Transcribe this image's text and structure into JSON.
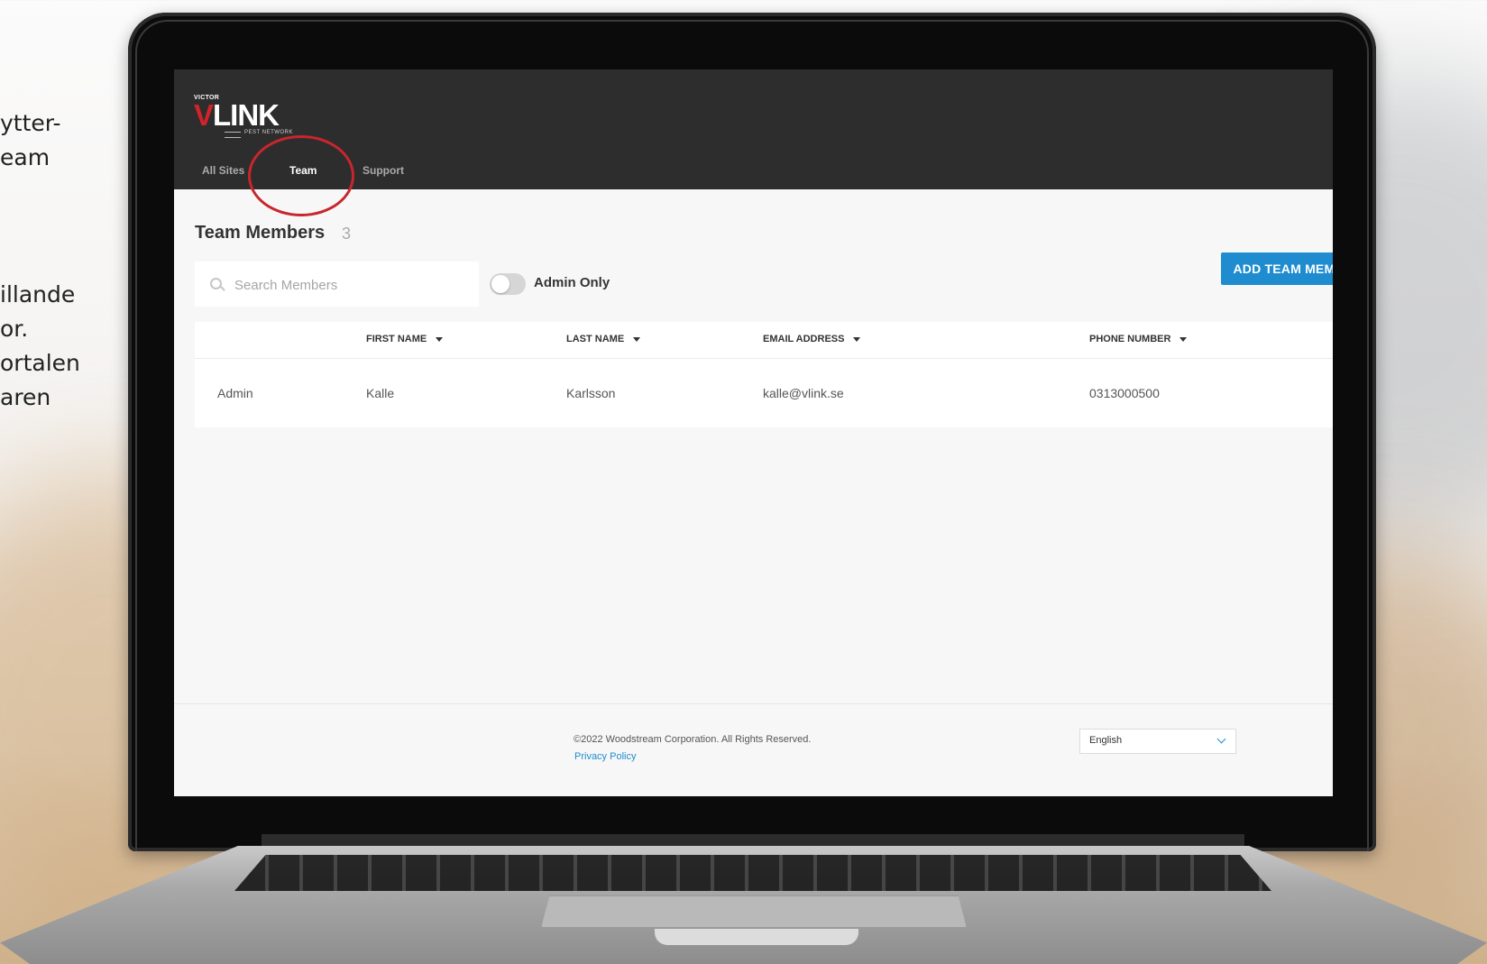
{
  "left_copy": {
    "top_lines": [
      "ytter-",
      "eam"
    ],
    "mid_lines": [
      "illande",
      "or.",
      "ortalen",
      "aren"
    ]
  },
  "app": {
    "logo": {
      "victor": "VICTOR",
      "wordmark_v": "V",
      "wordmark_rest": "LINK",
      "tagline": "PEST NETWORK"
    },
    "nav": {
      "tabs": [
        {
          "label": "All Sites",
          "active": false
        },
        {
          "label": "Team",
          "active": true
        },
        {
          "label": "Support",
          "active": false
        }
      ]
    },
    "header": {
      "title": "Team Members",
      "count": "3"
    },
    "search": {
      "placeholder": "Search Members",
      "value": ""
    },
    "filter": {
      "admin_only_label": "Admin Only",
      "admin_only": false
    },
    "add_button_label": "ADD TEAM MEMBER",
    "table": {
      "columns": [
        "",
        "FIRST NAME",
        "LAST NAME",
        "EMAIL ADDRESS",
        "PHONE NUMBER"
      ],
      "rows": [
        [
          "Admin",
          "Kalle",
          "Karlsson",
          "kalle@vlink.se",
          "0313000500"
        ]
      ]
    },
    "footer": {
      "copyright": "©2022 Woodstream Corporation. All Rights Reserved.",
      "privacy_link": "Privacy Policy",
      "language": "English"
    }
  },
  "colors": {
    "topbar": "#2d2d2d",
    "accent": "#1e8ccf",
    "brand_red": "#d0232a",
    "highlight_circle": "#c8262d"
  }
}
